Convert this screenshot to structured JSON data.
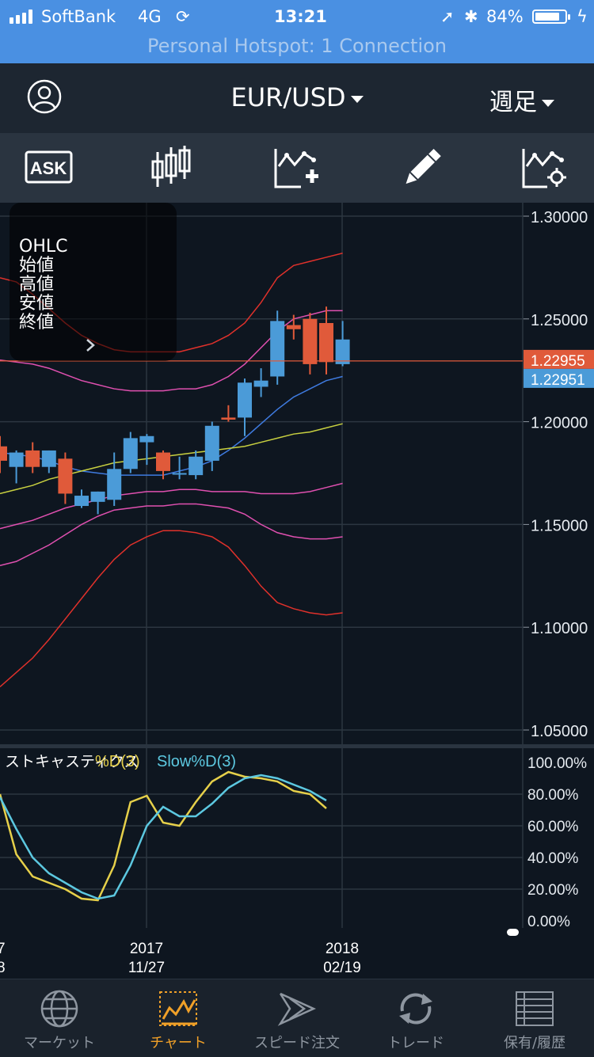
{
  "status_bar": {
    "carrier": "SoftBank",
    "network": "4G",
    "time": "13:21",
    "battery_pct": "84%",
    "battery_level": 0.84,
    "hotspot": "Personal Hotspot: 1 Connection"
  },
  "nav": {
    "pair": "EUR/USD",
    "period": "週足"
  },
  "toolbar": {
    "ask_label": "ASK",
    "icons": [
      "ask-icon",
      "candlestick-icon",
      "add-indicator-icon",
      "pencil-icon",
      "chart-settings-icon"
    ]
  },
  "ohlc_panel": {
    "title": "OHLC",
    "open": "始値",
    "high": "高値",
    "low": "安値",
    "close": "終値"
  },
  "price_axis": {
    "ticks": [
      "1.30000",
      "1.25000",
      "1.20000",
      "1.15000",
      "1.10000",
      "1.05000"
    ],
    "ask_price": "1.22955",
    "bid_price": "1.22951"
  },
  "stochastic": {
    "name": "ストキャスティクス",
    "d_label": "%D(3)",
    "slowd_label": "Slow%D(3)",
    "ticks": [
      "100.00%",
      "80.00%",
      "60.00%",
      "40.00%",
      "20.00%",
      "0.00%"
    ]
  },
  "x_axis": {
    "left_partial_top": "7",
    "left_partial_bottom": "8",
    "dates": [
      {
        "year": "2017",
        "date": "11/27"
      },
      {
        "year": "2018",
        "date": "02/19"
      }
    ]
  },
  "colors": {
    "up": "#4b9bd8",
    "down": "#e05a3a",
    "bb_outer": "#e0312b",
    "bb_inner": "#e050b0",
    "ma_short": "#3f7be0",
    "ma_long": "#c8d040",
    "stoch_d": "#e6d04a",
    "stoch_slow": "#5cc8e0",
    "active_tab": "#f0a028"
  },
  "chart_data": {
    "type": "candlestick",
    "ylim": [
      1.05,
      1.3
    ],
    "candles": [
      {
        "o": 1.188,
        "h": 1.193,
        "l": 1.175,
        "c": 1.181
      },
      {
        "o": 1.178,
        "h": 1.186,
        "l": 1.17,
        "c": 1.185
      },
      {
        "o": 1.186,
        "h": 1.19,
        "l": 1.175,
        "c": 1.178
      },
      {
        "o": 1.178,
        "h": 1.186,
        "l": 1.175,
        "c": 1.186
      },
      {
        "o": 1.182,
        "h": 1.185,
        "l": 1.16,
        "c": 1.165
      },
      {
        "o": 1.159,
        "h": 1.167,
        "l": 1.158,
        "c": 1.164
      },
      {
        "o": 1.161,
        "h": 1.166,
        "l": 1.155,
        "c": 1.166
      },
      {
        "o": 1.162,
        "h": 1.185,
        "l": 1.159,
        "c": 1.177
      },
      {
        "o": 1.177,
        "h": 1.195,
        "l": 1.175,
        "c": 1.192
      },
      {
        "o": 1.19,
        "h": 1.194,
        "l": 1.179,
        "c": 1.193
      },
      {
        "o": 1.185,
        "h": 1.186,
        "l": 1.172,
        "c": 1.176
      },
      {
        "o": 1.175,
        "h": 1.183,
        "l": 1.172,
        "c": 1.175
      },
      {
        "o": 1.174,
        "h": 1.186,
        "l": 1.172,
        "c": 1.183
      },
      {
        "o": 1.181,
        "h": 1.2,
        "l": 1.176,
        "c": 1.198
      },
      {
        "o": 1.202,
        "h": 1.208,
        "l": 1.2,
        "c": 1.201
      },
      {
        "o": 1.202,
        "h": 1.221,
        "l": 1.193,
        "c": 1.219
      },
      {
        "o": 1.217,
        "h": 1.226,
        "l": 1.212,
        "c": 1.22
      },
      {
        "o": 1.222,
        "h": 1.254,
        "l": 1.218,
        "c": 1.249
      },
      {
        "o": 1.247,
        "h": 1.252,
        "l": 1.24,
        "c": 1.245
      },
      {
        "o": 1.25,
        "h": 1.253,
        "l": 1.223,
        "c": 1.228
      },
      {
        "o": 1.248,
        "h": 1.256,
        "l": 1.223,
        "c": 1.229
      },
      {
        "o": 1.228,
        "h": 1.249,
        "l": 1.227,
        "c": 1.24
      }
    ],
    "bb_upper2": [
      1.27,
      1.268,
      1.262,
      1.255,
      1.248,
      1.242,
      1.238,
      1.235,
      1.234,
      1.234,
      1.234,
      1.234,
      1.236,
      1.238,
      1.242,
      1.248,
      1.258,
      1.27,
      1.276,
      1.278,
      1.28,
      1.282
    ],
    "bb_upper1": [
      1.23,
      1.229,
      1.228,
      1.226,
      1.223,
      1.22,
      1.218,
      1.216,
      1.215,
      1.215,
      1.215,
      1.216,
      1.216,
      1.218,
      1.222,
      1.228,
      1.236,
      1.244,
      1.25,
      1.252,
      1.254,
      1.254
    ],
    "ma_mid": [
      1.185,
      1.184,
      1.183,
      1.181,
      1.178,
      1.176,
      1.175,
      1.174,
      1.174,
      1.174,
      1.174,
      1.176,
      1.178,
      1.181,
      1.186,
      1.192,
      1.199,
      1.206,
      1.212,
      1.216,
      1.22,
      1.222
    ],
    "ma_long": [
      1.165,
      1.167,
      1.169,
      1.172,
      1.174,
      1.176,
      1.178,
      1.18,
      1.181,
      1.182,
      1.183,
      1.184,
      1.185,
      1.186,
      1.187,
      1.188,
      1.19,
      1.192,
      1.194,
      1.195,
      1.197,
      1.199
    ],
    "bb_lower1": [
      1.148,
      1.15,
      1.152,
      1.155,
      1.158,
      1.16,
      1.162,
      1.164,
      1.165,
      1.166,
      1.166,
      1.167,
      1.167,
      1.166,
      1.166,
      1.166,
      1.165,
      1.165,
      1.165,
      1.166,
      1.168,
      1.17
    ],
    "bb_lower2": [
      1.1,
      1.104,
      1.108,
      1.114,
      1.121,
      1.128,
      1.134,
      1.139,
      1.143,
      1.146,
      1.147,
      1.148,
      1.148,
      1.147,
      1.145,
      1.14,
      1.134,
      1.13,
      1.128,
      1.126,
      1.125,
      1.125
    ],
    "bb_lower1b": [
      1.13,
      1.132,
      1.136,
      1.14,
      1.145,
      1.15,
      1.154,
      1.157,
      1.158,
      1.159,
      1.159,
      1.16,
      1.16,
      1.159,
      1.158,
      1.155,
      1.15,
      1.146,
      1.144,
      1.143,
      1.143,
      1.144
    ],
    "bb_lower2b": [
      1.071,
      1.078,
      1.085,
      1.094,
      1.104,
      1.114,
      1.124,
      1.133,
      1.14,
      1.144,
      1.147,
      1.147,
      1.146,
      1.144,
      1.139,
      1.13,
      1.12,
      1.112,
      1.109,
      1.107,
      1.106,
      1.107
    ],
    "stoch_d": [
      80,
      42,
      28,
      24,
      20,
      14,
      13,
      35,
      75,
      79,
      62,
      60,
      75,
      88,
      94,
      91,
      90,
      88,
      82,
      80,
      71
    ],
    "stoch_slow": [
      78,
      58,
      40,
      30,
      24,
      18,
      14,
      16,
      35,
      60,
      72,
      66,
      66,
      74,
      84,
      90,
      92,
      90,
      86,
      82,
      76
    ]
  },
  "tabs": [
    {
      "label": "マーケット",
      "icon": "globe-icon"
    },
    {
      "label": "チャート",
      "icon": "chart-icon"
    },
    {
      "label": "スピード注文",
      "icon": "speed-order-icon"
    },
    {
      "label": "トレード",
      "icon": "trade-icon"
    },
    {
      "label": "保有/履歴",
      "icon": "history-icon"
    }
  ]
}
